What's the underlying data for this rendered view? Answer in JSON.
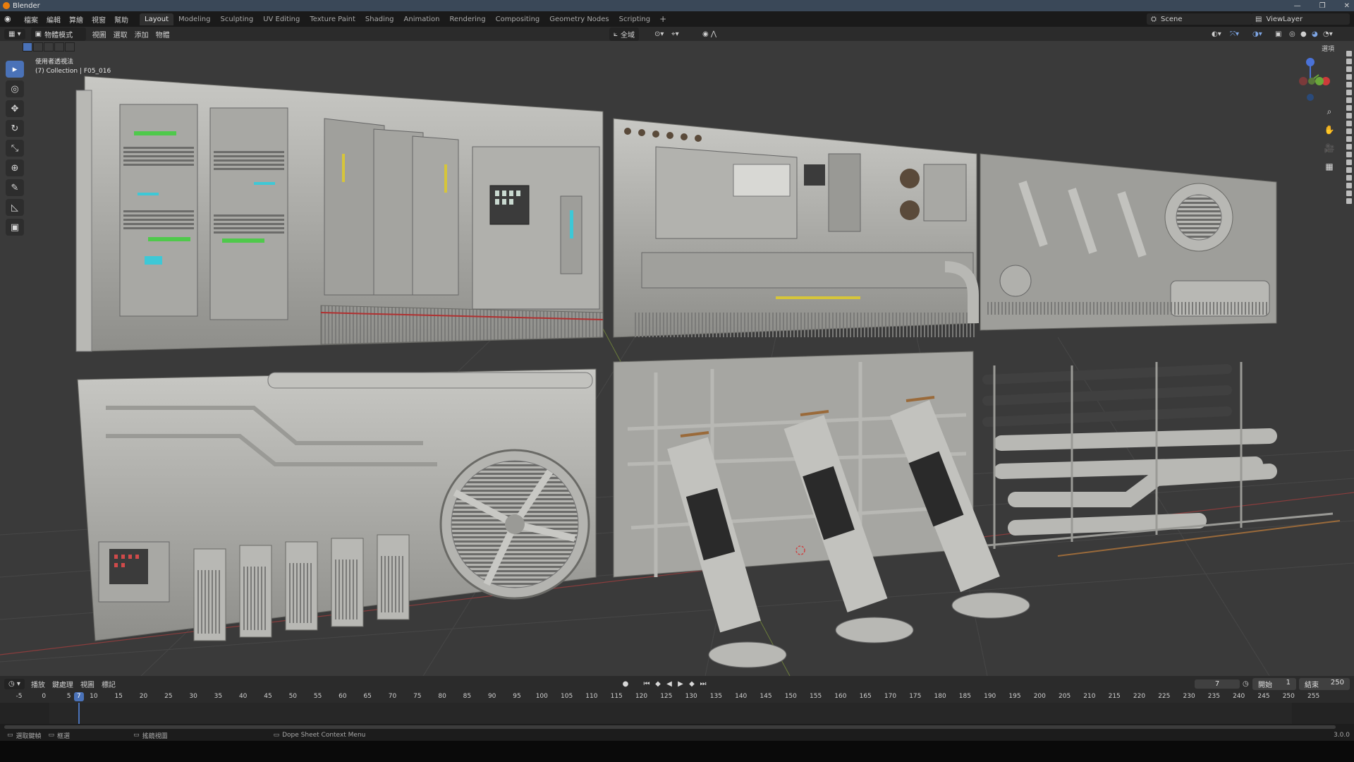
{
  "app": {
    "title": "Blender",
    "version": "3.0.0"
  },
  "menubar": {
    "menus": [
      "檔案",
      "編輯",
      "算繪",
      "視窗",
      "幫助"
    ],
    "workspaces": [
      "Layout",
      "Modeling",
      "Sculpting",
      "UV Editing",
      "Texture Paint",
      "Shading",
      "Animation",
      "Rendering",
      "Compositing",
      "Geometry Nodes",
      "Scripting"
    ],
    "active_workspace": "Layout",
    "add_tab": "+",
    "scene": "Scene",
    "view_layer": "ViewLayer"
  },
  "header3d": {
    "mode": "物體模式",
    "menus": [
      "視圖",
      "選取",
      "添加",
      "物體"
    ],
    "orientation": "全域",
    "options": "選項"
  },
  "viewport": {
    "view_name": "使用者透視法",
    "collection_info": "(7) Collection | F05_016"
  },
  "toolbar": {
    "tools": [
      {
        "name": "select-box-tool",
        "glyph": "▸",
        "active": true
      },
      {
        "name": "cursor-tool",
        "glyph": "◎",
        "active": false
      },
      {
        "name": "move-tool",
        "glyph": "✥",
        "active": false
      },
      {
        "name": "rotate-tool",
        "glyph": "↻",
        "active": false
      },
      {
        "name": "scale-tool",
        "glyph": "⤡",
        "active": false
      },
      {
        "name": "transform-tool",
        "glyph": "⊕",
        "active": false
      },
      {
        "name": "annotate-tool",
        "glyph": "✎",
        "active": false
      },
      {
        "name": "measure-tool",
        "glyph": "◺",
        "active": false
      },
      {
        "name": "add-cube-tool",
        "glyph": "▣",
        "active": false
      }
    ]
  },
  "timeline": {
    "menus": [
      "播放",
      "鍵處理",
      "視圖",
      "標記"
    ],
    "current_frame": "7",
    "start_label": "開始",
    "start": "1",
    "end_label": "結束",
    "end": "250",
    "ticks": [
      "-5",
      "0",
      "5",
      "10",
      "15",
      "20",
      "25",
      "30",
      "35",
      "40",
      "45",
      "50",
      "55",
      "60",
      "65",
      "70",
      "75",
      "80",
      "85",
      "90",
      "95",
      "100",
      "105",
      "110",
      "115",
      "120",
      "125",
      "130",
      "135",
      "140",
      "145",
      "150",
      "155",
      "160",
      "165",
      "170",
      "175",
      "180",
      "185",
      "190",
      "195",
      "200",
      "205",
      "210",
      "215",
      "220",
      "225",
      "230",
      "235",
      "240",
      "245",
      "250",
      "255"
    ]
  },
  "statusbar": {
    "items": [
      "選取鍵幀",
      "框選",
      "搖鏡視圖",
      "Dope Sheet Context Menu"
    ]
  },
  "colors": {
    "accent": "#4a72b8",
    "titlebar": "#3a4858",
    "logo": "#e87d0d"
  }
}
